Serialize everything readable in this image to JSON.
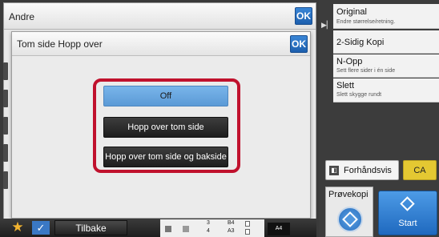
{
  "base_panel": {
    "title": "Andre",
    "ok_label": "OK"
  },
  "dialog": {
    "title": "Tom side Hopp over",
    "ok_label": "OK",
    "options": [
      {
        "label": "Off",
        "selected": true
      },
      {
        "label": "Hopp over tom side",
        "selected": false
      },
      {
        "label": "Hopp over tom side og bakside",
        "selected": false
      }
    ]
  },
  "bottom_bar": {
    "star_icon": "star-icon",
    "check_icon": "check-icon",
    "back_label": "Tilbake",
    "trays": [
      {
        "number": "3",
        "size": "B4"
      },
      {
        "number": "4",
        "size": "A3"
      }
    ],
    "active_paper": "A4"
  },
  "right_menu": {
    "items": [
      {
        "title": "Original",
        "subtitle": "Endre størrelse/retning."
      },
      {
        "title": "2-Sidig Kopi",
        "subtitle": ""
      },
      {
        "title": "N-Opp",
        "subtitle": "Sett flere sider i én side"
      },
      {
        "title": "Slett",
        "subtitle": "Slett skygge rundt"
      }
    ]
  },
  "actions": {
    "preview_label": "Forhåndsvis",
    "ca_label": "CA",
    "proof_label": "Prøvekopi",
    "start_label": "Start"
  },
  "colors": {
    "accent_blue": "#2a6fbf",
    "highlight_red": "#c0112d",
    "ca_yellow": "#e4c832"
  }
}
